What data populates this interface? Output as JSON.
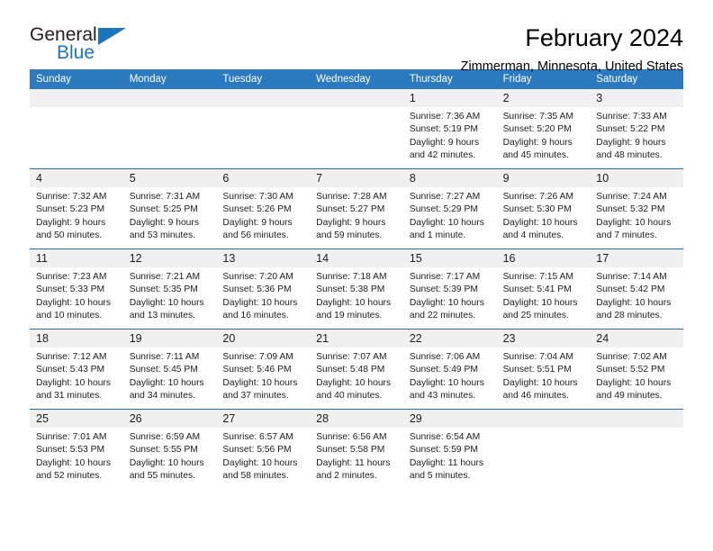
{
  "brand": {
    "name_top": "General",
    "name_bottom": "Blue"
  },
  "header": {
    "title": "February 2024",
    "subtitle": "Zimmerman, Minnesota, United States"
  },
  "colors": {
    "header_blue": "#2b7ac0",
    "rule_blue": "#2b6ca8",
    "daynum_band": "#f0f0f0",
    "brand_blue": "#1b75bb"
  },
  "weekdays": [
    "Sunday",
    "Monday",
    "Tuesday",
    "Wednesday",
    "Thursday",
    "Friday",
    "Saturday"
  ],
  "weeks": [
    [
      {
        "day": "",
        "lines": []
      },
      {
        "day": "",
        "lines": []
      },
      {
        "day": "",
        "lines": []
      },
      {
        "day": "",
        "lines": []
      },
      {
        "day": "1",
        "lines": [
          "Sunrise: 7:36 AM",
          "Sunset: 5:19 PM",
          "Daylight: 9 hours",
          "and 42 minutes."
        ]
      },
      {
        "day": "2",
        "lines": [
          "Sunrise: 7:35 AM",
          "Sunset: 5:20 PM",
          "Daylight: 9 hours",
          "and 45 minutes."
        ]
      },
      {
        "day": "3",
        "lines": [
          "Sunrise: 7:33 AM",
          "Sunset: 5:22 PM",
          "Daylight: 9 hours",
          "and 48 minutes."
        ]
      }
    ],
    [
      {
        "day": "4",
        "lines": [
          "Sunrise: 7:32 AM",
          "Sunset: 5:23 PM",
          "Daylight: 9 hours",
          "and 50 minutes."
        ]
      },
      {
        "day": "5",
        "lines": [
          "Sunrise: 7:31 AM",
          "Sunset: 5:25 PM",
          "Daylight: 9 hours",
          "and 53 minutes."
        ]
      },
      {
        "day": "6",
        "lines": [
          "Sunrise: 7:30 AM",
          "Sunset: 5:26 PM",
          "Daylight: 9 hours",
          "and 56 minutes."
        ]
      },
      {
        "day": "7",
        "lines": [
          "Sunrise: 7:28 AM",
          "Sunset: 5:27 PM",
          "Daylight: 9 hours",
          "and 59 minutes."
        ]
      },
      {
        "day": "8",
        "lines": [
          "Sunrise: 7:27 AM",
          "Sunset: 5:29 PM",
          "Daylight: 10 hours",
          "and 1 minute."
        ]
      },
      {
        "day": "9",
        "lines": [
          "Sunrise: 7:26 AM",
          "Sunset: 5:30 PM",
          "Daylight: 10 hours",
          "and 4 minutes."
        ]
      },
      {
        "day": "10",
        "lines": [
          "Sunrise: 7:24 AM",
          "Sunset: 5:32 PM",
          "Daylight: 10 hours",
          "and 7 minutes."
        ]
      }
    ],
    [
      {
        "day": "11",
        "lines": [
          "Sunrise: 7:23 AM",
          "Sunset: 5:33 PM",
          "Daylight: 10 hours",
          "and 10 minutes."
        ]
      },
      {
        "day": "12",
        "lines": [
          "Sunrise: 7:21 AM",
          "Sunset: 5:35 PM",
          "Daylight: 10 hours",
          "and 13 minutes."
        ]
      },
      {
        "day": "13",
        "lines": [
          "Sunrise: 7:20 AM",
          "Sunset: 5:36 PM",
          "Daylight: 10 hours",
          "and 16 minutes."
        ]
      },
      {
        "day": "14",
        "lines": [
          "Sunrise: 7:18 AM",
          "Sunset: 5:38 PM",
          "Daylight: 10 hours",
          "and 19 minutes."
        ]
      },
      {
        "day": "15",
        "lines": [
          "Sunrise: 7:17 AM",
          "Sunset: 5:39 PM",
          "Daylight: 10 hours",
          "and 22 minutes."
        ]
      },
      {
        "day": "16",
        "lines": [
          "Sunrise: 7:15 AM",
          "Sunset: 5:41 PM",
          "Daylight: 10 hours",
          "and 25 minutes."
        ]
      },
      {
        "day": "17",
        "lines": [
          "Sunrise: 7:14 AM",
          "Sunset: 5:42 PM",
          "Daylight: 10 hours",
          "and 28 minutes."
        ]
      }
    ],
    [
      {
        "day": "18",
        "lines": [
          "Sunrise: 7:12 AM",
          "Sunset: 5:43 PM",
          "Daylight: 10 hours",
          "and 31 minutes."
        ]
      },
      {
        "day": "19",
        "lines": [
          "Sunrise: 7:11 AM",
          "Sunset: 5:45 PM",
          "Daylight: 10 hours",
          "and 34 minutes."
        ]
      },
      {
        "day": "20",
        "lines": [
          "Sunrise: 7:09 AM",
          "Sunset: 5:46 PM",
          "Daylight: 10 hours",
          "and 37 minutes."
        ]
      },
      {
        "day": "21",
        "lines": [
          "Sunrise: 7:07 AM",
          "Sunset: 5:48 PM",
          "Daylight: 10 hours",
          "and 40 minutes."
        ]
      },
      {
        "day": "22",
        "lines": [
          "Sunrise: 7:06 AM",
          "Sunset: 5:49 PM",
          "Daylight: 10 hours",
          "and 43 minutes."
        ]
      },
      {
        "day": "23",
        "lines": [
          "Sunrise: 7:04 AM",
          "Sunset: 5:51 PM",
          "Daylight: 10 hours",
          "and 46 minutes."
        ]
      },
      {
        "day": "24",
        "lines": [
          "Sunrise: 7:02 AM",
          "Sunset: 5:52 PM",
          "Daylight: 10 hours",
          "and 49 minutes."
        ]
      }
    ],
    [
      {
        "day": "25",
        "lines": [
          "Sunrise: 7:01 AM",
          "Sunset: 5:53 PM",
          "Daylight: 10 hours",
          "and 52 minutes."
        ]
      },
      {
        "day": "26",
        "lines": [
          "Sunrise: 6:59 AM",
          "Sunset: 5:55 PM",
          "Daylight: 10 hours",
          "and 55 minutes."
        ]
      },
      {
        "day": "27",
        "lines": [
          "Sunrise: 6:57 AM",
          "Sunset: 5:56 PM",
          "Daylight: 10 hours",
          "and 58 minutes."
        ]
      },
      {
        "day": "28",
        "lines": [
          "Sunrise: 6:56 AM",
          "Sunset: 5:58 PM",
          "Daylight: 11 hours",
          "and 2 minutes."
        ]
      },
      {
        "day": "29",
        "lines": [
          "Sunrise: 6:54 AM",
          "Sunset: 5:59 PM",
          "Daylight: 11 hours",
          "and 5 minutes."
        ]
      },
      {
        "day": "",
        "lines": []
      },
      {
        "day": "",
        "lines": []
      }
    ]
  ]
}
